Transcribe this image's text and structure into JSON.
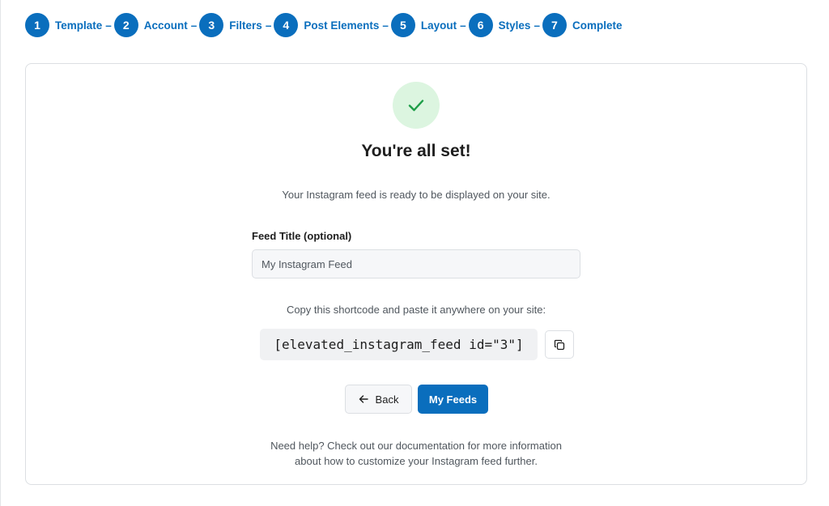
{
  "stepper": {
    "steps": [
      {
        "number": "1",
        "label": "Template"
      },
      {
        "number": "2",
        "label": "Account"
      },
      {
        "number": "3",
        "label": "Filters"
      },
      {
        "number": "4",
        "label": "Post Elements"
      },
      {
        "number": "5",
        "label": "Layout"
      },
      {
        "number": "6",
        "label": "Styles"
      },
      {
        "number": "7",
        "label": "Complete"
      }
    ],
    "separator": "–"
  },
  "success": {
    "icon": "checkmark-icon",
    "title": "You're all set!",
    "subtitle": "Your Instagram feed is ready to be displayed on your site."
  },
  "feed_title": {
    "label": "Feed Title (optional)",
    "value": "",
    "placeholder": "My Instagram Feed"
  },
  "shortcode": {
    "instruction": "Copy this shortcode and paste it anywhere on your site:",
    "code": "[elevated_instagram_feed id=\"3\"]",
    "copy_icon": "copy-icon"
  },
  "actions": {
    "back_label": "Back",
    "my_feeds_label": "My Feeds"
  },
  "help": {
    "line1": "Need help? Check out our documentation for more information",
    "line2": "about how to customize your Instagram feed further."
  },
  "colors": {
    "accent": "#0a6ebd",
    "success_bg": "#dcf5e0",
    "success_check": "#1e9e48"
  }
}
